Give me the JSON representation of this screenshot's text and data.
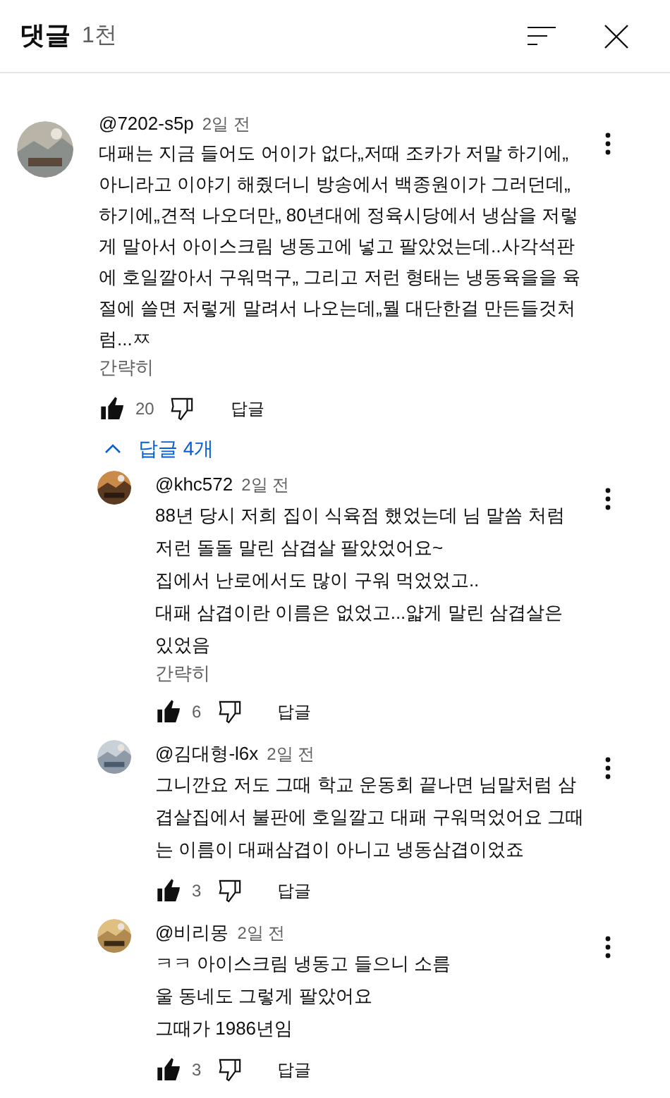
{
  "header": {
    "title": "댓글",
    "count": "1천"
  },
  "comment": {
    "author": "@7202-s5p",
    "time": "2일 전",
    "lines": [
      "대패는 지금 들어도 어이가 없다„저때 조카가 저말 하기에„",
      "아니라고 이야기 해줬더니 방송에서 백종원이가 그러던데„",
      "하기에„견적 나오더만„ 80년대에 정육시당에서 냉삼을 저렇",
      "게 말아서  아이스크림 냉동고에 넣고 팔았었는데..사각석판",
      "에 호일깔아서 구워먹구„ 그리고 저런 형태는 냉동육을을 육",
      "절에 쓸면 저렇게 말려서 나오는데„뭘 대단한걸 만든들것처",
      "럼...ㅉ"
    ],
    "collapse": "간략히",
    "likes": "20",
    "liked": true,
    "reply": "답글"
  },
  "replies_toggle": {
    "label": "답글 4개",
    "expanded": true
  },
  "replies": [
    {
      "author": "@khc572",
      "time": "2일 전",
      "lines": [
        "88년 당시 저희 집이 식육점 했었는데 님 말씀 처럼",
        "저런 돌돌 말린 삼겹살 팔았었어요~",
        "집에서 난로에서도 많이 구워 먹었었고..",
        "대패 삼겹이란 이름은 없었고...얇게 말린 삼겹살은",
        "있었음"
      ],
      "collapse": "간략히",
      "likes": "6",
      "liked": true,
      "reply": "답글"
    },
    {
      "author": "@김대형-l6x",
      "time": "2일 전",
      "lines": [
        "그니깐요 저도 그때 학교 운동회 끝나면 님말처럼 삼",
        "겹살집에서 불판에 호일깔고 대패 구워먹었어요 그때",
        "는 이름이 대패삼겹이 아니고 냉동삼겹이었죠"
      ],
      "likes": "3",
      "liked": true,
      "reply": "답글"
    },
    {
      "author": "@비리몽",
      "time": "2일 전",
      "lines": [
        "ㅋㅋ 아이스크림 냉동고 들으니 소름",
        "울 동네도 그렇게 팔았어요",
        "그때가 1986년임"
      ],
      "likes": "3",
      "liked": true,
      "reply": "답글"
    }
  ]
}
